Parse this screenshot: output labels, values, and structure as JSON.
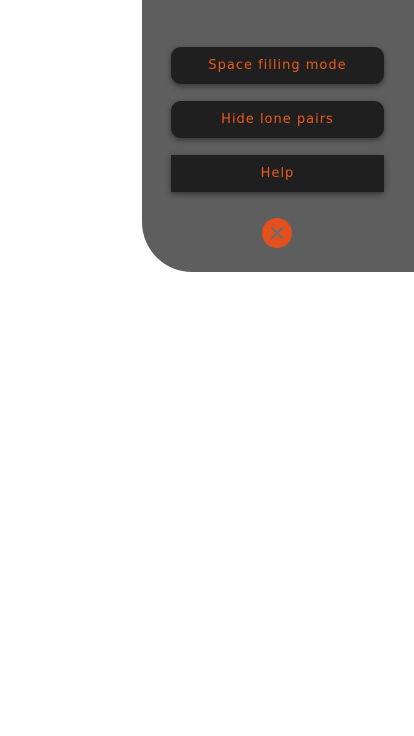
{
  "menu": {
    "buttons": [
      {
        "label": "Space filling mode"
      },
      {
        "label": "Hide lone pairs"
      },
      {
        "label": "Help"
      }
    ],
    "close_icon": "close-icon"
  },
  "colors": {
    "panel_bg": "#5e5e5e",
    "button_bg": "#1f1f1f",
    "accent": "#ea5a1f",
    "close_bg": "#e3501e",
    "close_x": "#6b6b6b"
  }
}
